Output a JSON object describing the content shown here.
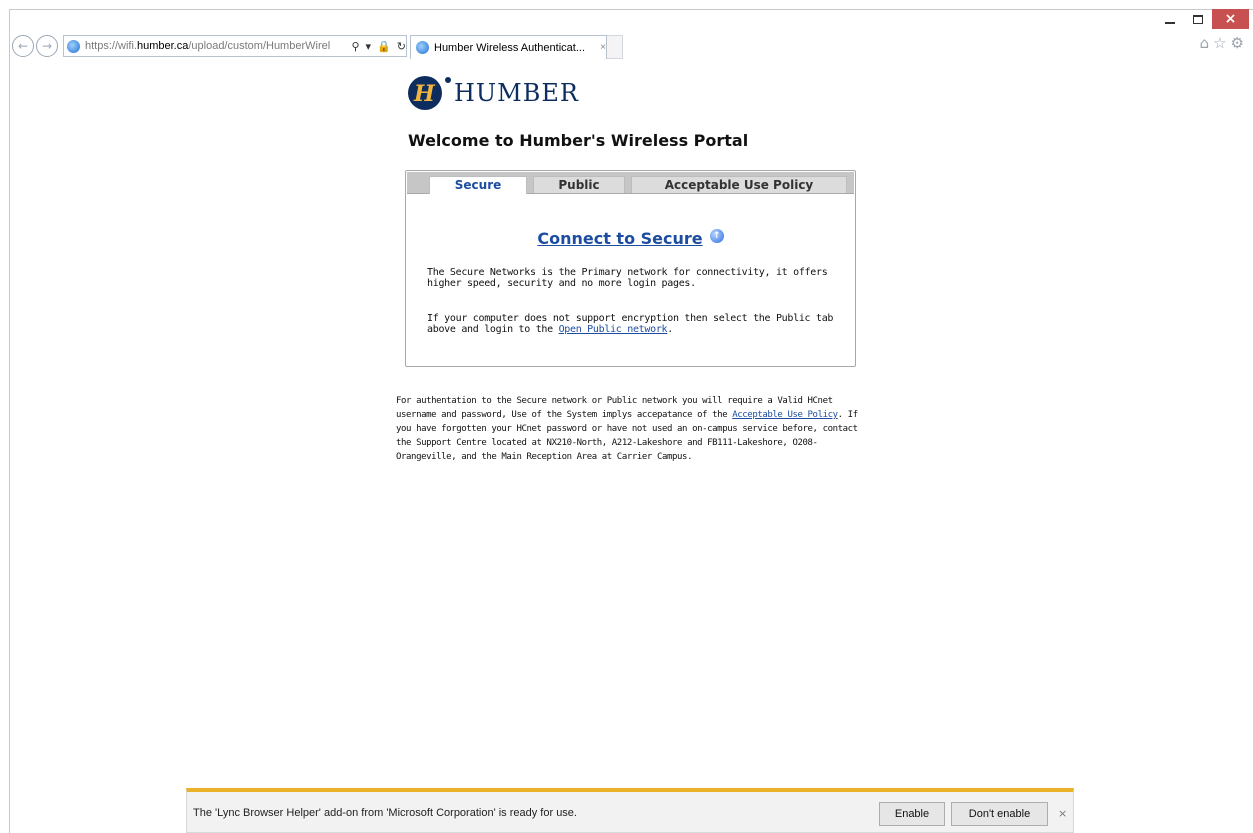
{
  "browser": {
    "url_prefix": "https://wifi.",
    "url_domain": "humber.ca",
    "url_path": "/upload/custom/HumberWirel",
    "tab_title": "Humber Wireless Authenticat...",
    "tab_close": "×",
    "icons": [
      "back-icon",
      "forward-icon",
      "search-icon",
      "lock-icon",
      "refresh-icon",
      "home-icon",
      "star-icon",
      "gear-icon"
    ]
  },
  "window": {
    "close_glyph": "×"
  },
  "logo": {
    "text": "HUMBER",
    "mark": "H"
  },
  "page": {
    "title": "Welcome to Humber's Wireless Portal",
    "tabs": [
      {
        "label": "Secure",
        "active": true
      },
      {
        "label": "Public",
        "active": false
      },
      {
        "label": "Acceptable Use Policy",
        "active": false
      }
    ],
    "connect_link": "Connect to Secure",
    "paragraph1": "The Secure Networks is the Primary network for connectivity, it offers higher speed, security and no more login pages.",
    "paragraph2_before": "If your computer does not support encryption then select the Public tab above and login to the ",
    "paragraph2_link": "Open Public network",
    "paragraph2_after": ".",
    "footer_before": "For authentation to the Secure network or Public network you will require a Valid HCnet username and password, Use of the System implys accepatance of the ",
    "footer_link": "Acceptable Use Policy",
    "footer_after": ". If you have forgotten your HCnet password or have not used an on-campus service before, contact the Support Centre located at NX210-North, A212-Lakeshore and FB111-Lakeshore, O208-Orangeville, and the Main Reception Area at Carrier Campus."
  },
  "notification": {
    "message": "The 'Lync Browser Helper' add-on from 'Microsoft Corporation' is ready for use.",
    "enable_label": "Enable",
    "dont_enable_label": "Don't enable",
    "close_glyph": "×",
    "accent_color": "#eab12a"
  },
  "colors": {
    "link": "#1c4da1",
    "brand": "#0c2d5e",
    "brand_gold": "#f1b43c"
  }
}
